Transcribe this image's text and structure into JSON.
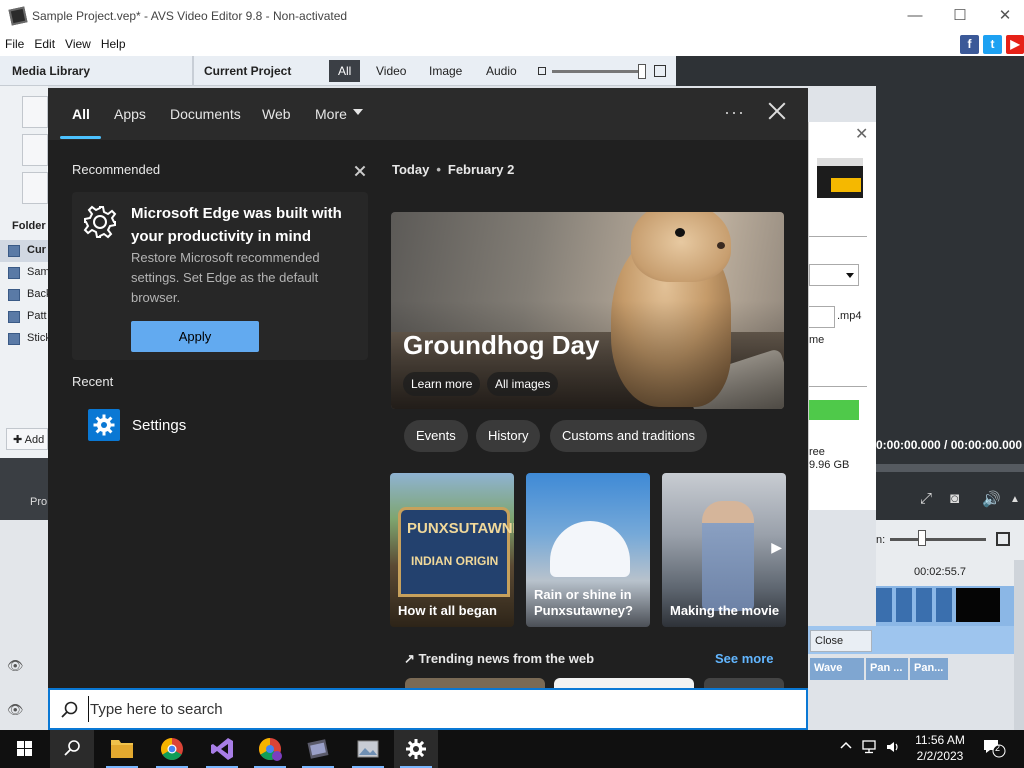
{
  "app": {
    "window_title": "Sample Project.vep* - AVS Video Editor 9.8 - Non-activated",
    "menu": [
      "File",
      "Edit",
      "View",
      "Help"
    ],
    "media_library": "Media Library",
    "current_project": "Current Project",
    "filter_tabs": [
      "All",
      "Video",
      "Image",
      "Audio"
    ],
    "left_fragments": {
      "folders": "Folder",
      "rows": [
        "Cur",
        "Sam",
        "Back",
        "Patt",
        "Stick"
      ],
      "add": "Add",
      "project": "Pro"
    },
    "dialog": {
      "ext": ".mp4",
      "me": "me",
      "free1": "ree",
      "free2": "9.96 GB",
      "close": "Close"
    },
    "player_time": "0:00:00.000 / 00:00:00.000",
    "zoom_label": "n:",
    "ruler_time": "00:02:55.7",
    "transitions": [
      "Wave",
      "Pan ...",
      "Pan..."
    ]
  },
  "search": {
    "tabs": [
      "All",
      "Apps",
      "Documents",
      "Web",
      "More"
    ],
    "ellipsis": "···",
    "recommended": {
      "heading": "Recommended",
      "title": "Microsoft Edge was built with your productivity in mind",
      "description": "Restore Microsoft recommended settings. Set Edge as the default browser.",
      "button": "Apply"
    },
    "recent": {
      "heading": "Recent",
      "items": [
        "Settings"
      ]
    },
    "today": {
      "label": "Today",
      "date": "February 2"
    },
    "hero": {
      "title": "Groundhog Day",
      "buttons": [
        "Learn more",
        "All images"
      ]
    },
    "chips": [
      "Events",
      "History",
      "Customs and traditions"
    ],
    "cards": [
      {
        "caption": "How it all began",
        "sign_line1": "PUNXSUTAWNE",
        "sign_line2": "INDIAN ORIGIN"
      },
      {
        "caption": "Rain or shine in Punxsutawney?"
      },
      {
        "caption": "Making the movie"
      }
    ],
    "trending": "Trending news from the web",
    "see_more": "See more",
    "placeholder": "Type here to search"
  },
  "taskbar": {
    "time": "11:56 AM",
    "date": "2/2/2023",
    "notification_count": "2"
  },
  "colors": {
    "accent": "#4cc2ff",
    "apply": "#62aaf0",
    "see_more": "#62b6ff",
    "settings_tile": "#0a78d4"
  }
}
